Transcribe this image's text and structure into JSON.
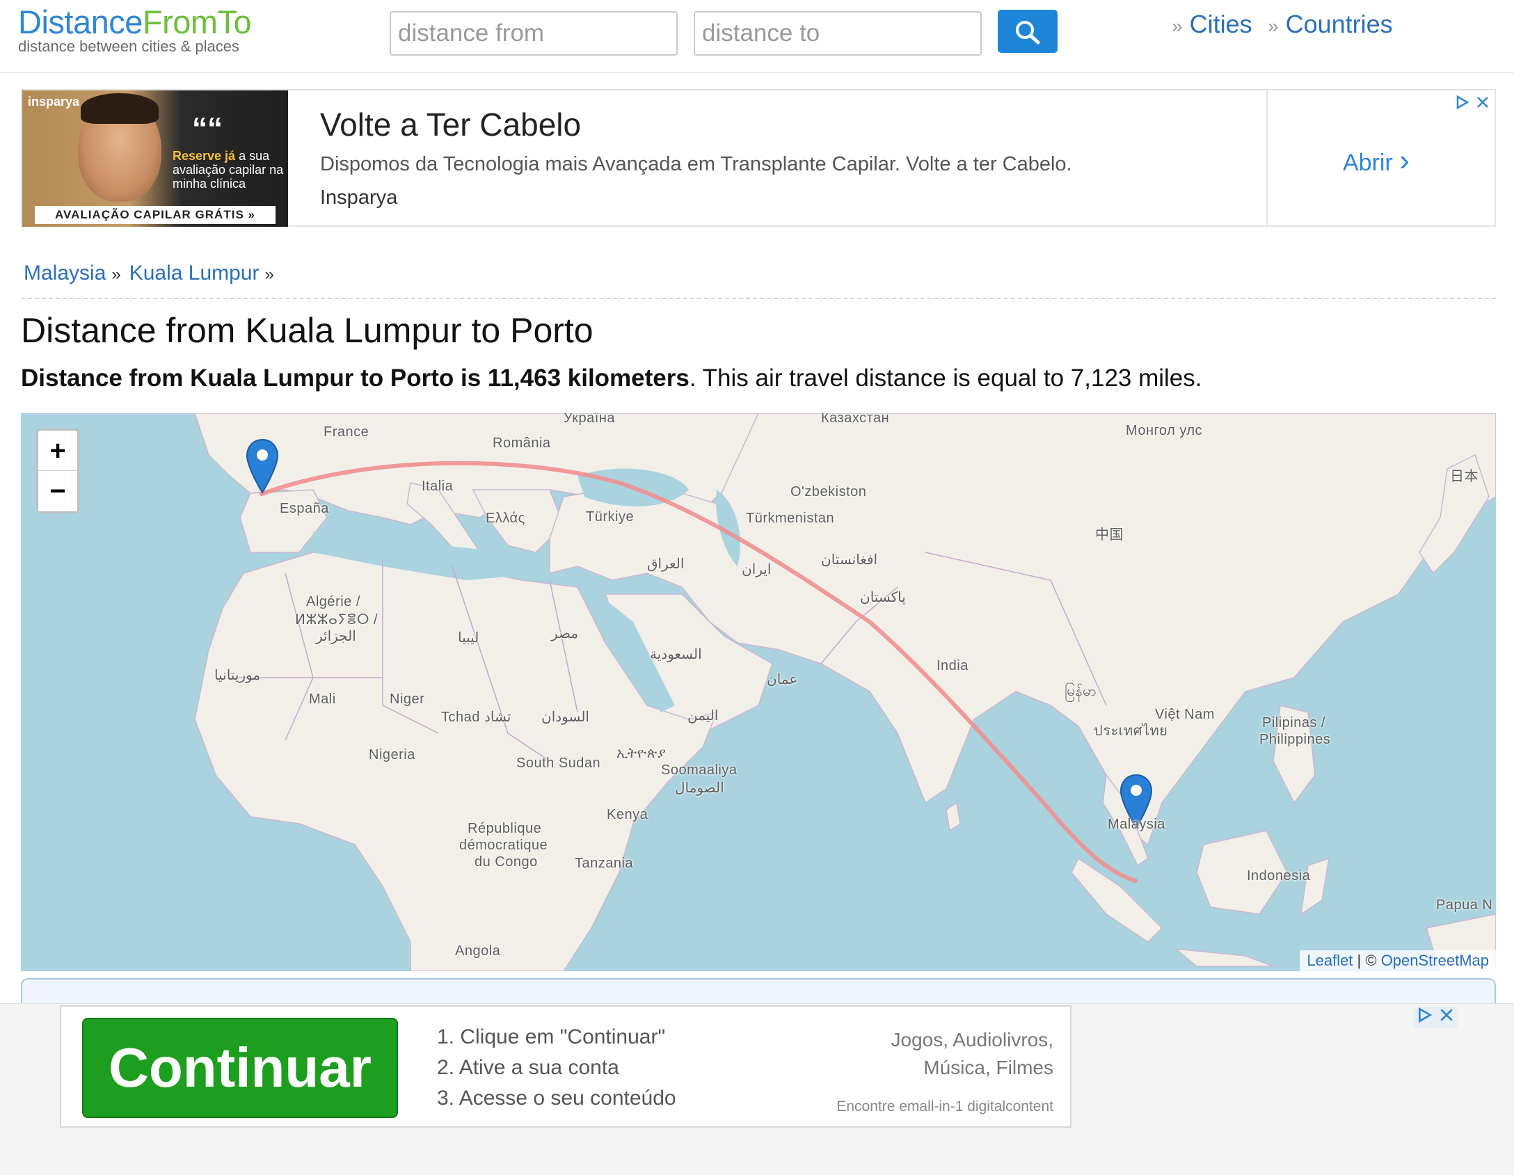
{
  "header": {
    "logo_part1": "Distance",
    "logo_part2": "FromTo",
    "logo_tagline": "distance between cities & places",
    "from_placeholder": "distance from",
    "to_placeholder": "distance to",
    "nav": [
      {
        "sep": "»",
        "label": "Cities"
      },
      {
        "sep": "»",
        "label": "Countries"
      }
    ]
  },
  "ad_top": {
    "brand": "insparya",
    "quote_mark": "““",
    "promo_highlight": "Reserve já",
    "promo_text": " a sua avaliação capilar na minha clínica",
    "promo_strip": "AVALIAÇÃO CAPILAR GRÁTIS »",
    "title": "Volte a Ter Cabelo",
    "description": "Dispomos da Tecnologia mais Avançada em Transplante Capilar. Volte a ter Cabelo.",
    "advertiser": "Insparya",
    "cta": "Abrir",
    "cta_arrow": "›"
  },
  "breadcrumb": [
    {
      "label": "Malaysia",
      "sep": "»"
    },
    {
      "label": "Kuala Lumpur",
      "sep": "»"
    }
  ],
  "page": {
    "title": "Distance from Kuala Lumpur to Porto",
    "summary_bold": "Distance from Kuala Lumpur to Porto is 11,463 kilometers",
    "summary_rest": ". This air travel distance is equal to 7,123 miles."
  },
  "map": {
    "zoom_in": "+",
    "zoom_out": "−",
    "attribution_leaflet": "Leaflet",
    "attribution_sep": " | © ",
    "attribution_osm": "OpenStreetMap",
    "route_color": "#f08f8f",
    "marker_color": "#2a7fd6",
    "labels": {
      "ukraine": "Україна",
      "kazakhstan": "Казахстан",
      "france": "France",
      "romania": "România",
      "mongolia": "Монгол улс",
      "japan": "日本",
      "italia": "Italia",
      "espana": "España",
      "greece": "Ελλάς",
      "turkiye": "Türkiye",
      "uzbekistan": "O'zbekiston",
      "turkmenistan": "Türkmenistan",
      "china": "中国",
      "iraq": "العراق",
      "iran": "ایران",
      "afghanistan": "افغانستان",
      "pakistan": "پاکستان",
      "algeria1": "Algérie /",
      "algeria2": "ⵍⵣⵣⴰⵢⴻⵔ /",
      "algeria3": "الجزائر",
      "libya": "ليبيا",
      "egypt": "مصر",
      "saudi": "السعودية",
      "mauritania": "موريتانيا",
      "oman": "عمان",
      "india": "India",
      "myanmar": "မြန်မာ",
      "mali": "Mali",
      "niger": "Niger",
      "chad": "Tchad تشاد",
      "sudan": "السودان",
      "yemen": "اليمن",
      "vietnam": "Việt Nam",
      "thailand": "ประเทศไทย",
      "philippines1": "Pilipinas /",
      "philippines2": "Philippines",
      "nigeria": "Nigeria",
      "ethiopia": "ኢትዮጵያ",
      "south_sudan": "South Sudan",
      "somalia1": "Soomaaliya",
      "somalia2": "الصومال",
      "malaysia": "Malaysia",
      "kenya": "Kenya",
      "drc1": "République",
      "drc2": "démocratique",
      "drc3": "du Congo",
      "indonesia": "Indonesia",
      "tanzania": "Tanzania",
      "papua": "Papua N",
      "angola": "Angola"
    }
  },
  "ad_bottom": {
    "button": "Continuar",
    "steps": [
      "1. Clique em \"Continuar\"",
      "2. Ative a sua conta",
      "3. Acesse o seu conteúdo"
    ],
    "tags_line1": "Jogos, Audiolivros,",
    "tags_line2": "Música, Filmes",
    "source": "Encontre emall-in-1 digitalcontent"
  }
}
